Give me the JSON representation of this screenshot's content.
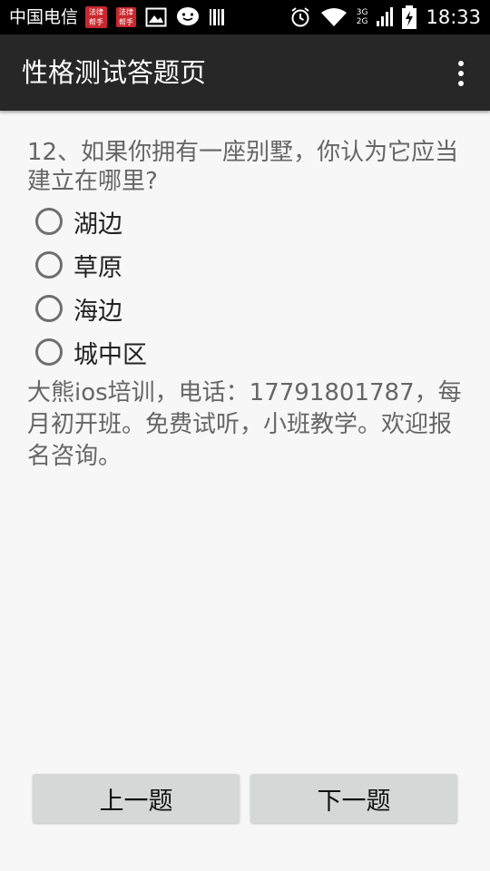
{
  "status_bar": {
    "carrier": "中国电信",
    "time": "18:33",
    "network_top": "3G",
    "network_bottom": "2G",
    "app_icon_1": "法律\n帮手",
    "app_icon_2": "法律\n帮手",
    "icons": [
      "law-app-icon",
      "law-app-icon",
      "image-icon",
      "chat-bubble-icon",
      "barcode-icon",
      "alarm-icon",
      "wifi-icon",
      "signal-icon",
      "battery-charging-icon"
    ]
  },
  "app_bar": {
    "title": "性格测试答题页",
    "menu_icon": "overflow-menu-icon"
  },
  "quiz": {
    "question": "12、如果你拥有一座别墅，你认为它应当建立在哪里?",
    "options": [
      {
        "label": "湖边"
      },
      {
        "label": "草原"
      },
      {
        "label": "海边"
      },
      {
        "label": "城中区"
      }
    ],
    "ad_text": "大熊ios培训，电话：17791801787，每月初开班。免费试听，小班教学。欢迎报名咨询。"
  },
  "buttons": {
    "prev": "上一题",
    "next": "下一题"
  },
  "colors": {
    "status_bar": "#000000",
    "app_bar": "#272727",
    "background": "#f7f7f7",
    "button": "#d6d7d7",
    "secondary_text": "#666666"
  }
}
